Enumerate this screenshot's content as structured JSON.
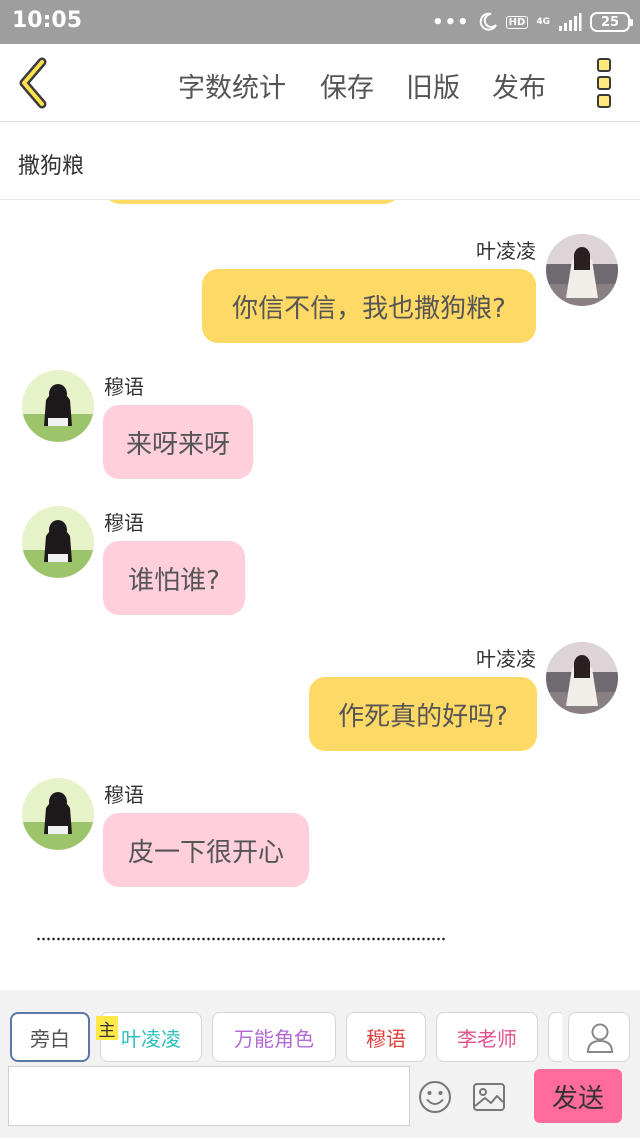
{
  "status_bar": {
    "time": "10:05",
    "network": "4G",
    "hd_label": "HD",
    "battery": "25"
  },
  "nav": {
    "word_count": "字数统计",
    "save": "保存",
    "old_version": "旧版",
    "publish": "发布"
  },
  "title": "撒狗粮",
  "messages": [
    {
      "speaker": "叶凌凌",
      "text": "你信不信，我也撒狗粮?"
    },
    {
      "speaker": "穆语",
      "text": "来呀来呀"
    },
    {
      "speaker": "穆语",
      "text": "谁怕谁?"
    },
    {
      "speaker": "叶凌凌",
      "text": "作死真的好吗?"
    },
    {
      "speaker": "穆语",
      "text": "皮一下很开心"
    }
  ],
  "roles": {
    "narration": "旁白",
    "main_tag": "主",
    "items": [
      {
        "label": "叶凌凌",
        "color": "#2bbfbf"
      },
      {
        "label": "万能角色",
        "color": "#b36bd6"
      },
      {
        "label": "穆语",
        "color": "#e0413c"
      },
      {
        "label": "李老师",
        "color": "#e0528e"
      }
    ]
  },
  "input": {
    "placeholder": "",
    "send": "发送"
  },
  "colors": {
    "accent": "#ff6b9d",
    "bubble_right": "#ffd966",
    "bubble_left": "#ffd0dc",
    "main_tag": "#ffe94a"
  },
  "icons": [
    "back-chevron-icon",
    "more-menu-icon",
    "emoji-icon",
    "image-icon",
    "user-icon",
    "moon-icon",
    "signal-icon"
  ]
}
